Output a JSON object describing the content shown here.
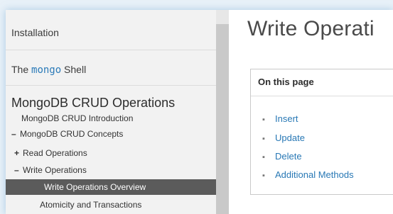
{
  "sidebar": {
    "installation": "Installation",
    "mongo_shell_prefix": "The ",
    "mongo_shell_code": "mongo",
    "mongo_shell_suffix": " Shell",
    "section_title": "MongoDB CRUD Operations",
    "items": [
      {
        "marker": "",
        "label": "MongoDB CRUD Introduction"
      },
      {
        "marker": "–",
        "label": "MongoDB CRUD Concepts"
      },
      {
        "marker": "+",
        "label": "Read Operations"
      },
      {
        "marker": "–",
        "label": "Write Operations"
      }
    ],
    "active_item": "Write Operations Overview",
    "next_item": "Atomicity and Transactions"
  },
  "main": {
    "title": "Write Operati",
    "toc_header": "On this page",
    "toc_bullet": "▪",
    "toc_items": [
      "Insert",
      "Update",
      "Delete",
      "Additional Methods"
    ]
  }
}
